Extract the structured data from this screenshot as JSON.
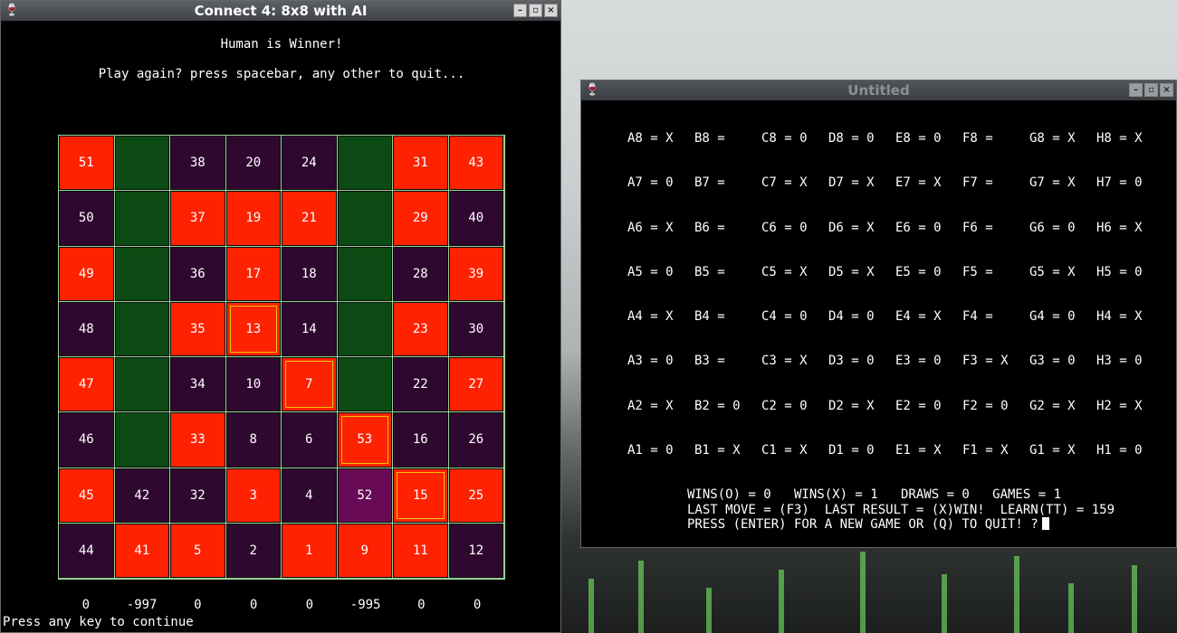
{
  "connect4": {
    "title": "Connect 4: 8x8 with AI",
    "winner_msg": "Human is Winner!",
    "prompt_msg": "Play again? press spacebar, any other to quit...",
    "footer": "Press any key to continue",
    "board": [
      [
        {
          "t": "51",
          "c": "red"
        },
        {
          "t": "",
          "c": "green"
        },
        {
          "t": "38",
          "c": "dark"
        },
        {
          "t": "20",
          "c": "dark"
        },
        {
          "t": "24",
          "c": "dark"
        },
        {
          "t": "",
          "c": "green"
        },
        {
          "t": "31",
          "c": "red"
        },
        {
          "t": "43",
          "c": "red"
        }
      ],
      [
        {
          "t": "50",
          "c": "dark"
        },
        {
          "t": "",
          "c": "green"
        },
        {
          "t": "37",
          "c": "red"
        },
        {
          "t": "19",
          "c": "red"
        },
        {
          "t": "21",
          "c": "red"
        },
        {
          "t": "",
          "c": "green"
        },
        {
          "t": "29",
          "c": "red"
        },
        {
          "t": "40",
          "c": "dark"
        }
      ],
      [
        {
          "t": "49",
          "c": "red"
        },
        {
          "t": "",
          "c": "green"
        },
        {
          "t": "36",
          "c": "dark"
        },
        {
          "t": "17",
          "c": "red"
        },
        {
          "t": "18",
          "c": "dark"
        },
        {
          "t": "",
          "c": "green"
        },
        {
          "t": "28",
          "c": "dark"
        },
        {
          "t": "39",
          "c": "red"
        }
      ],
      [
        {
          "t": "48",
          "c": "dark"
        },
        {
          "t": "",
          "c": "green"
        },
        {
          "t": "35",
          "c": "red"
        },
        {
          "t": "13",
          "c": "win"
        },
        {
          "t": "14",
          "c": "dark"
        },
        {
          "t": "",
          "c": "green"
        },
        {
          "t": "23",
          "c": "red"
        },
        {
          "t": "30",
          "c": "dark"
        }
      ],
      [
        {
          "t": "47",
          "c": "red"
        },
        {
          "t": "",
          "c": "green"
        },
        {
          "t": "34",
          "c": "dark"
        },
        {
          "t": "10",
          "c": "dark"
        },
        {
          "t": "7",
          "c": "win"
        },
        {
          "t": "",
          "c": "green"
        },
        {
          "t": "22",
          "c": "dark"
        },
        {
          "t": "27",
          "c": "red"
        }
      ],
      [
        {
          "t": "46",
          "c": "dark"
        },
        {
          "t": "",
          "c": "green"
        },
        {
          "t": "33",
          "c": "red"
        },
        {
          "t": "8",
          "c": "dark"
        },
        {
          "t": "6",
          "c": "dark"
        },
        {
          "t": "53",
          "c": "win"
        },
        {
          "t": "16",
          "c": "dark"
        },
        {
          "t": "26",
          "c": "dark"
        }
      ],
      [
        {
          "t": "45",
          "c": "red"
        },
        {
          "t": "42",
          "c": "dark"
        },
        {
          "t": "32",
          "c": "dark"
        },
        {
          "t": "3",
          "c": "red"
        },
        {
          "t": "4",
          "c": "dark"
        },
        {
          "t": "52",
          "c": "mag"
        },
        {
          "t": "15",
          "c": "win"
        },
        {
          "t": "25",
          "c": "red"
        }
      ],
      [
        {
          "t": "44",
          "c": "dark"
        },
        {
          "t": "41",
          "c": "red"
        },
        {
          "t": "5",
          "c": "red"
        },
        {
          "t": "2",
          "c": "dark"
        },
        {
          "t": "1",
          "c": "red"
        },
        {
          "t": "9",
          "c": "red"
        },
        {
          "t": "11",
          "c": "red"
        },
        {
          "t": "12",
          "c": "dark"
        }
      ]
    ],
    "scores": [
      "0",
      "-997",
      "0",
      "0",
      "0",
      "-995",
      "0",
      "0"
    ],
    "colors": {
      "red": "#ff2200",
      "dark": "#2f0830",
      "green": "#0b4a12",
      "highlight": "#e8c400",
      "grid": "#9bd29b"
    }
  },
  "console": {
    "title": "Untitled",
    "rows": [
      [
        "A8 = X",
        "B8 =",
        "C8 = 0",
        "D8 = 0",
        "E8 = 0",
        "F8 =",
        "G8 = X",
        "H8 = X"
      ],
      [
        "A7 = 0",
        "B7 =",
        "C7 = X",
        "D7 = X",
        "E7 = X",
        "F7 =",
        "G7 = X",
        "H7 = 0"
      ],
      [
        "A6 = X",
        "B6 =",
        "C6 = 0",
        "D6 = X",
        "E6 = 0",
        "F6 =",
        "G6 = 0",
        "H6 = X"
      ],
      [
        "A5 = 0",
        "B5 =",
        "C5 = X",
        "D5 = X",
        "E5 = 0",
        "F5 =",
        "G5 = X",
        "H5 = 0"
      ],
      [
        "A4 = X",
        "B4 =",
        "C4 = 0",
        "D4 = 0",
        "E4 = X",
        "F4 =",
        "G4 = 0",
        "H4 = X"
      ],
      [
        "A3 = 0",
        "B3 =",
        "C3 = X",
        "D3 = 0",
        "E3 = 0",
        "F3 = X",
        "G3 = 0",
        "H3 = 0"
      ],
      [
        "A2 = X",
        "B2 = 0",
        "C2 = 0",
        "D2 = X",
        "E2 = 0",
        "F2 = 0",
        "G2 = X",
        "H2 = X"
      ],
      [
        "A1 = 0",
        "B1 = X",
        "C1 = X",
        "D1 = 0",
        "E1 = X",
        "F1 = X",
        "G1 = X",
        "H1 = 0"
      ]
    ],
    "stats_line1": "WINS(O) = 0   WINS(X) = 1   DRAWS = 0   GAMES = 1",
    "stats_line2": "LAST MOVE = (F3)  LAST RESULT = (X)WIN!  LEARN(TT) = 159",
    "stats_line3": "PRESS (ENTER) FOR A NEW GAME OR (Q) TO QUIT! ?"
  },
  "window_buttons": {
    "minimize": "–",
    "maximize": "▫",
    "close": "×"
  }
}
